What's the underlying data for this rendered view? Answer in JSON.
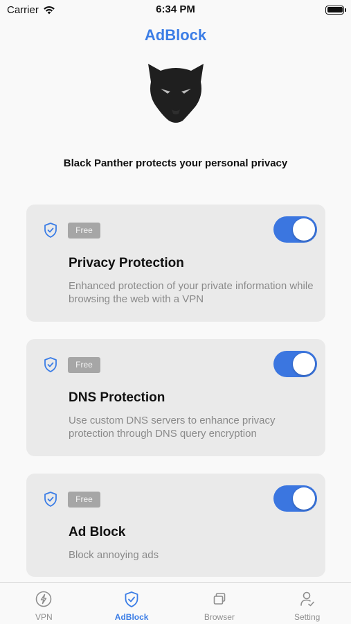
{
  "status_bar": {
    "carrier": "Carrier",
    "time": "6:34 PM"
  },
  "header": {
    "title": "AdBlock"
  },
  "tagline": "Black Panther protects your personal privacy",
  "colors": {
    "accent": "#3b7de6",
    "toggle_on": "#3b76e0",
    "card_bg": "#eaeaea",
    "badge_bg": "#a6a6a6"
  },
  "cards": [
    {
      "badge": "Free",
      "title": "Privacy Protection",
      "description": "Enhanced protection of your private information while browsing the web with a VPN",
      "enabled": true
    },
    {
      "badge": "Free",
      "title": "DNS Protection",
      "description": "Use custom DNS servers to enhance privacy protection through DNS query encryption",
      "enabled": true
    },
    {
      "badge": "Free",
      "title": "Ad Block",
      "description": "Block annoying ads",
      "enabled": true
    }
  ],
  "tabs": [
    {
      "label": "VPN",
      "icon": "lightning-bolt-icon",
      "active": false
    },
    {
      "label": "AdBlock",
      "icon": "shield-check-icon",
      "active": true
    },
    {
      "label": "Browser",
      "icon": "browser-windows-icon",
      "active": false
    },
    {
      "label": "Setting",
      "icon": "user-settings-icon",
      "active": false
    }
  ]
}
